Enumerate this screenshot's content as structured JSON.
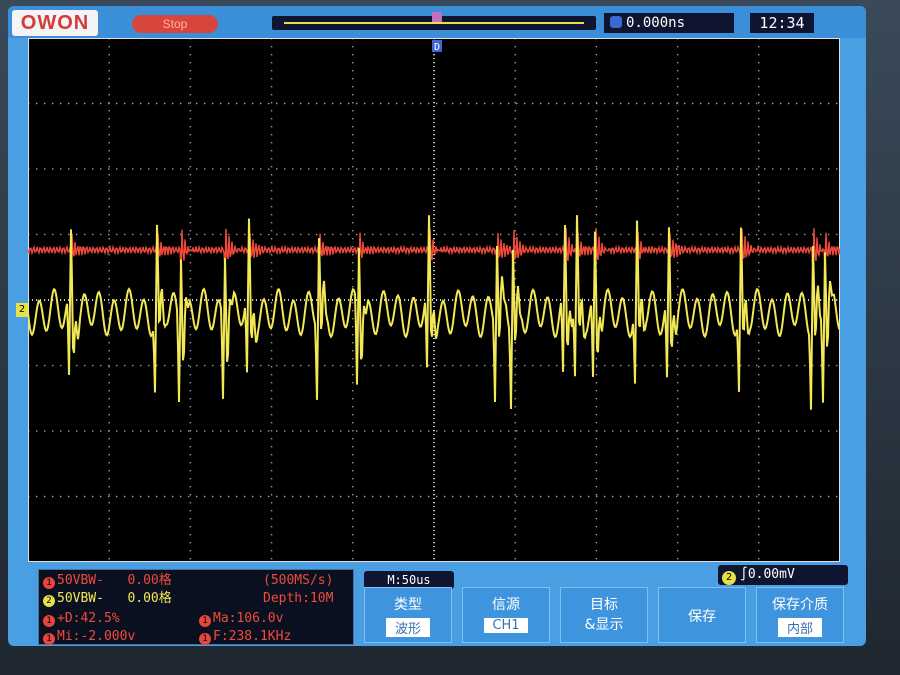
{
  "header": {
    "brand": "OWON",
    "run_state": "Stop",
    "time_offset": "0.000ns",
    "clock": "12:34"
  },
  "markers": {
    "ch2_ground": "2",
    "trigger_pos_label": "D"
  },
  "channels": [
    {
      "num": "1",
      "label": "50VBW-",
      "scale": "0.00格",
      "color": "#e8453c"
    },
    {
      "num": "2",
      "label": "50VBW-",
      "scale": "0.00格",
      "color": "#e8e047"
    }
  ],
  "acquisition": {
    "sample_rate": "(500MS/s)",
    "depth": "Depth:10M"
  },
  "measurements": [
    {
      "num": "1",
      "text": "+D:42.5%"
    },
    {
      "num": "1",
      "text": "Mi:-2.000v"
    },
    {
      "num": "1",
      "text": "Ma:106.0v"
    },
    {
      "num": "1",
      "text": "F:238.1KHz"
    }
  ],
  "timebase": "M:50us",
  "trigger": {
    "channel": "2",
    "edge": "∫",
    "level": "0.00mV"
  },
  "softkeys": [
    {
      "title": "类型",
      "value": "波形"
    },
    {
      "title": "信源",
      "value": "CH1"
    },
    {
      "title": "目标\n&显示",
      "value": ""
    },
    {
      "title": "保存",
      "value": ""
    },
    {
      "title": "保存介质",
      "value": "内部"
    }
  ]
}
